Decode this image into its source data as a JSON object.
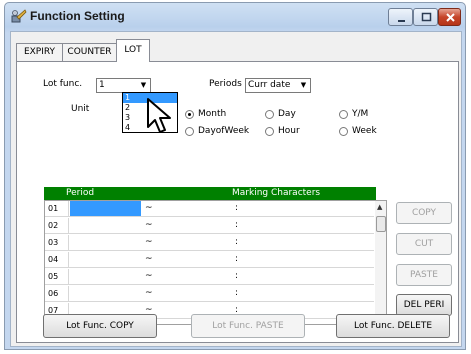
{
  "window": {
    "title": "Function Setting",
    "icon": "function-setting-icon"
  },
  "tabs": [
    {
      "label": "EXPIRY",
      "active": false
    },
    {
      "label": "COUNTER",
      "active": false
    },
    {
      "label": "LOT",
      "active": true
    }
  ],
  "lot_func": {
    "label": "Lot func.",
    "value": "1",
    "options": [
      "1",
      "2",
      "3",
      "4"
    ],
    "selected": "1"
  },
  "periods": {
    "label": "Periods",
    "value": "Curr date"
  },
  "unit": {
    "label": "Unit",
    "options": [
      {
        "label": "Month",
        "selected": true
      },
      {
        "label": "Day",
        "selected": false
      },
      {
        "label": "Y/M",
        "selected": false
      },
      {
        "label": "DayofWeek",
        "selected": false
      },
      {
        "label": "Hour",
        "selected": false
      },
      {
        "label": "Week",
        "selected": false
      }
    ]
  },
  "grid": {
    "headers": [
      "Period",
      "Marking Characters"
    ],
    "rows": [
      {
        "num": "01",
        "sep1": "~",
        "sep2": ":"
      },
      {
        "num": "02",
        "sep1": "~",
        "sep2": ":"
      },
      {
        "num": "03",
        "sep1": "~",
        "sep2": ":"
      },
      {
        "num": "04",
        "sep1": "~",
        "sep2": ":"
      },
      {
        "num": "05",
        "sep1": "~",
        "sep2": ":"
      },
      {
        "num": "06",
        "sep1": "~",
        "sep2": ":"
      },
      {
        "num": "07",
        "sep1": "~",
        "sep2": ":"
      }
    ]
  },
  "side_buttons": [
    {
      "label": "COPY",
      "enabled": false
    },
    {
      "label": "CUT",
      "enabled": false
    },
    {
      "label": "PASTE",
      "enabled": false
    },
    {
      "label": "DEL PERI",
      "enabled": true
    }
  ],
  "bottom_buttons": [
    {
      "label": "Lot Func. COPY",
      "enabled": true
    },
    {
      "label": "Lot Func. PASTE",
      "enabled": false
    },
    {
      "label": "Lot Func. DELETE",
      "enabled": true
    }
  ],
  "colors": {
    "grid_header": "#008000",
    "selection": "#3399ff",
    "window_frame": "#b9d0ec"
  }
}
